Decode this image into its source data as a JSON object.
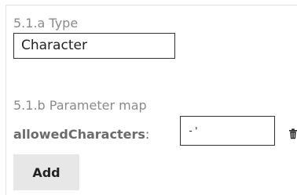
{
  "type_section": {
    "label": "5.1.a Type",
    "value": "Character"
  },
  "param_section": {
    "label": "5.1.b Parameter map",
    "rows": [
      {
        "key": "allowedCharacters",
        "separator": ":",
        "value": "-'",
        "delete_icon": "trash-icon"
      }
    ]
  },
  "actions": {
    "add_label": "Add"
  }
}
